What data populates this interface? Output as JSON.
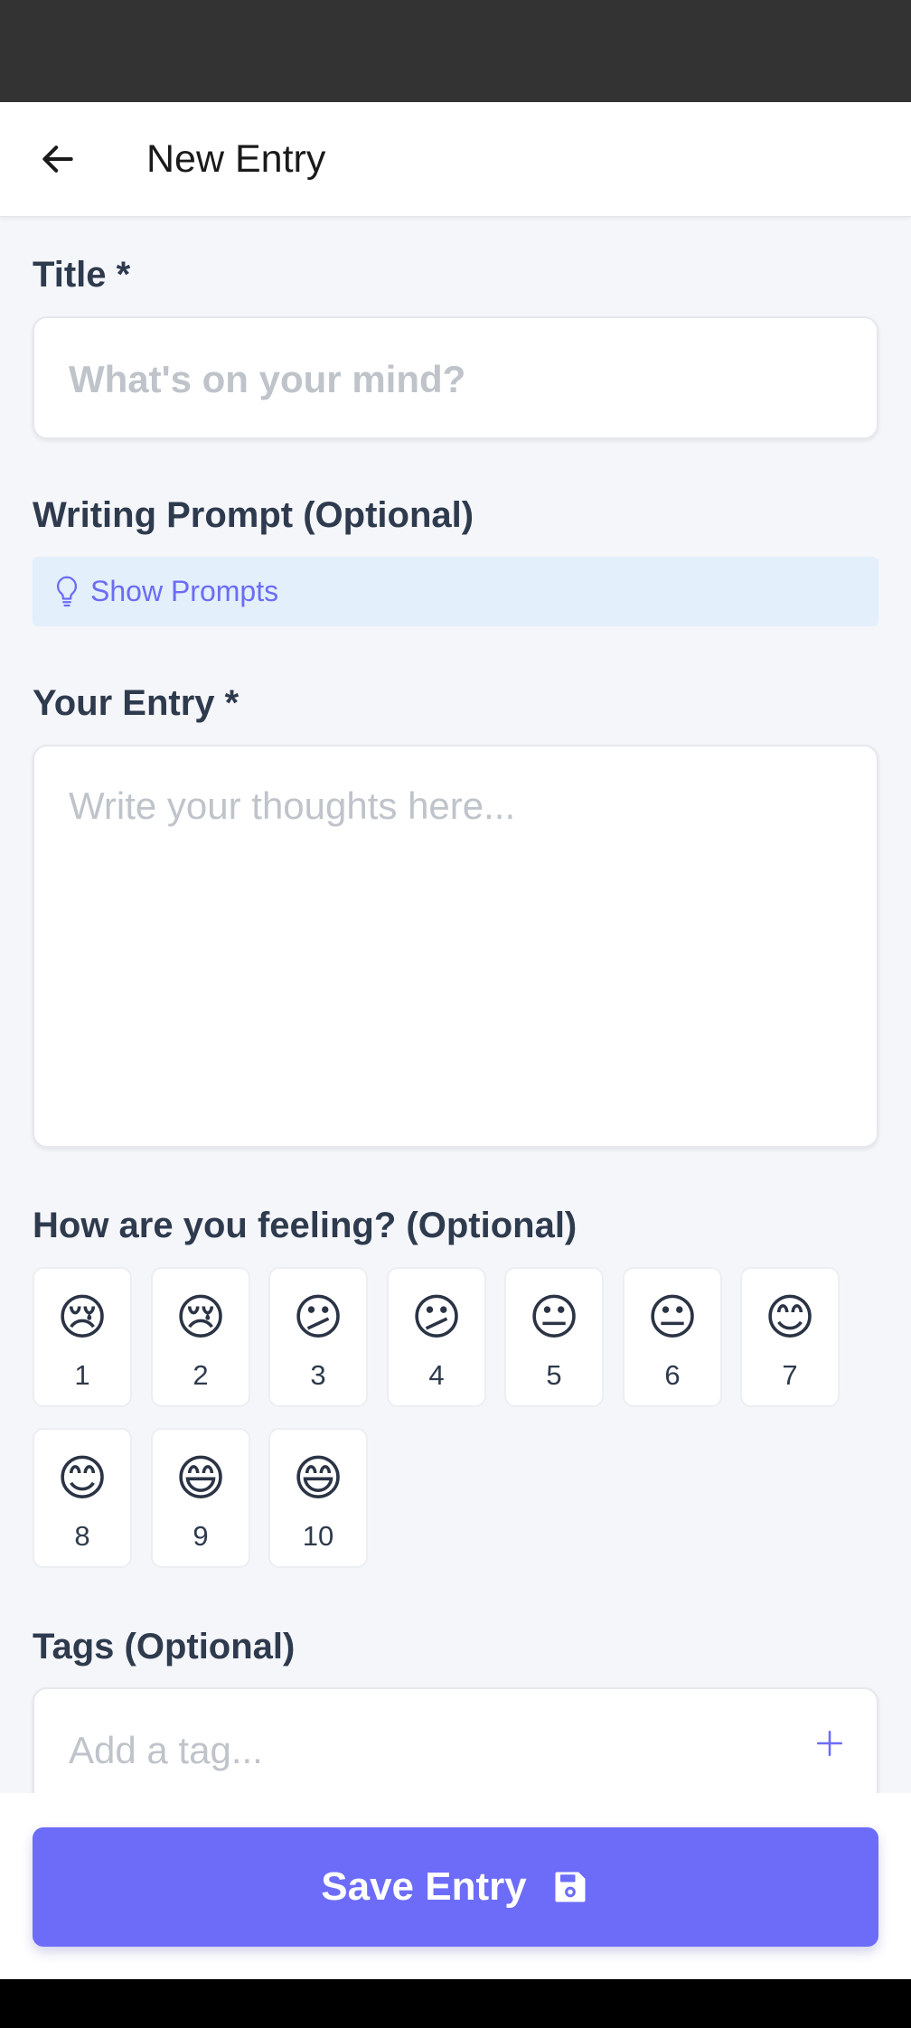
{
  "app_bar": {
    "title": "New Entry",
    "back_icon": "arrow-left-icon"
  },
  "title_field": {
    "label": "Title *",
    "placeholder": "What's on your mind?",
    "value": ""
  },
  "prompt_section": {
    "label": "Writing Prompt (Optional)",
    "button_label": "Show Prompts",
    "icon": "lightbulb-icon"
  },
  "entry_field": {
    "label": "Your Entry *",
    "placeholder": "Write your thoughts here...",
    "value": ""
  },
  "mood": {
    "label": "How are you feeling? (Optional)",
    "options": [
      {
        "emoji": "😢",
        "value": "1"
      },
      {
        "emoji": "😢",
        "value": "2"
      },
      {
        "emoji": "😕",
        "value": "3"
      },
      {
        "emoji": "😕",
        "value": "4"
      },
      {
        "emoji": "😐",
        "value": "5"
      },
      {
        "emoji": "😐",
        "value": "6"
      },
      {
        "emoji": "😊",
        "value": "7"
      },
      {
        "emoji": "😊",
        "value": "8"
      },
      {
        "emoji": "😄",
        "value": "9"
      },
      {
        "emoji": "😄",
        "value": "10"
      }
    ]
  },
  "tags": {
    "label": "Tags (Optional)",
    "placeholder": "Add a tag...",
    "add_icon": "plus-icon"
  },
  "save": {
    "label": "Save Entry",
    "icon": "save-disk-icon"
  },
  "colors": {
    "accent": "#6C6CF9",
    "prompt_bg": "#E3EFFB",
    "background": "#F5F6FA"
  }
}
